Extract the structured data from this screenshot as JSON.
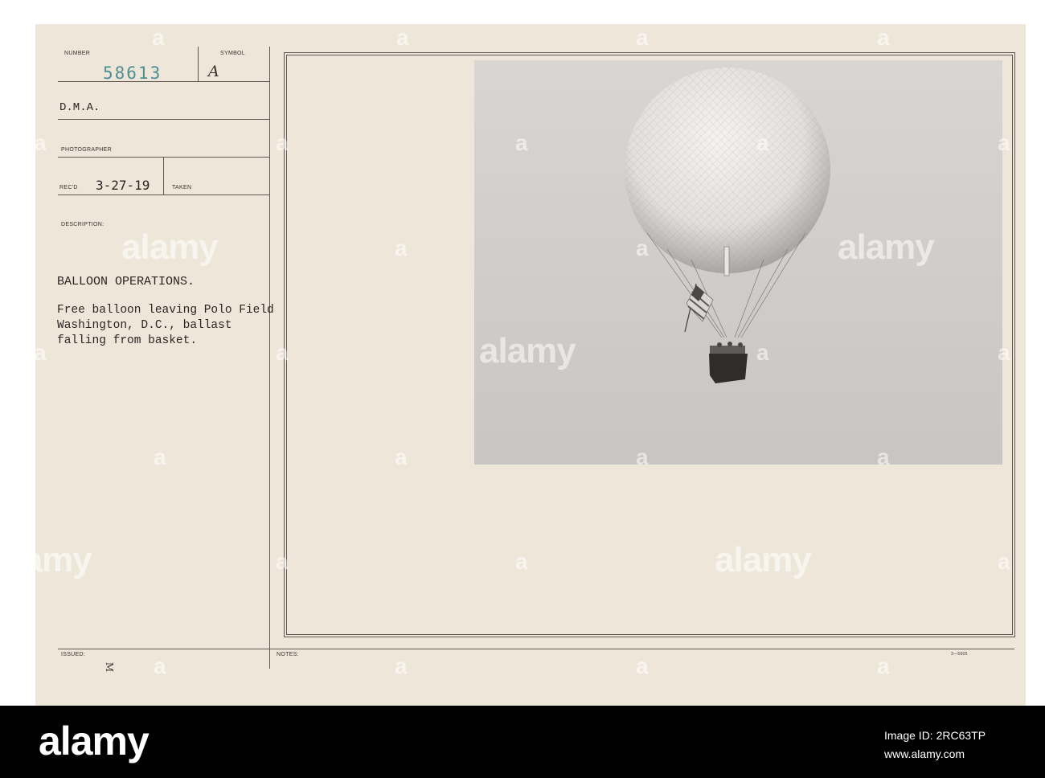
{
  "card": {
    "number_label": "NUMBER",
    "number_value": "58613",
    "symbol_label": "SYMBOL",
    "symbol_value": "A",
    "source": "D.M.A.",
    "photographer_label": "PHOTOGRAPHER",
    "recd_label": "REC'D",
    "recd_value": "3-27-19",
    "taken_label": "TAKEN",
    "description_label": "DESCRIPTION:",
    "description_title": "BALLOON OPERATIONS.",
    "description_lines": [
      "Free balloon leaving Polo Field",
      "Washington, D.C., ballast",
      "falling from basket."
    ],
    "issued_label": "ISSUED:",
    "issued_mark": "M",
    "notes_label": "NOTES:",
    "form_number": "3—5605"
  },
  "watermark": {
    "text": "alamy",
    "glyph": "a"
  },
  "footer": {
    "logo": "alamy",
    "image_id": "Image ID: 2RC63TP",
    "site": "www.alamy.com"
  }
}
